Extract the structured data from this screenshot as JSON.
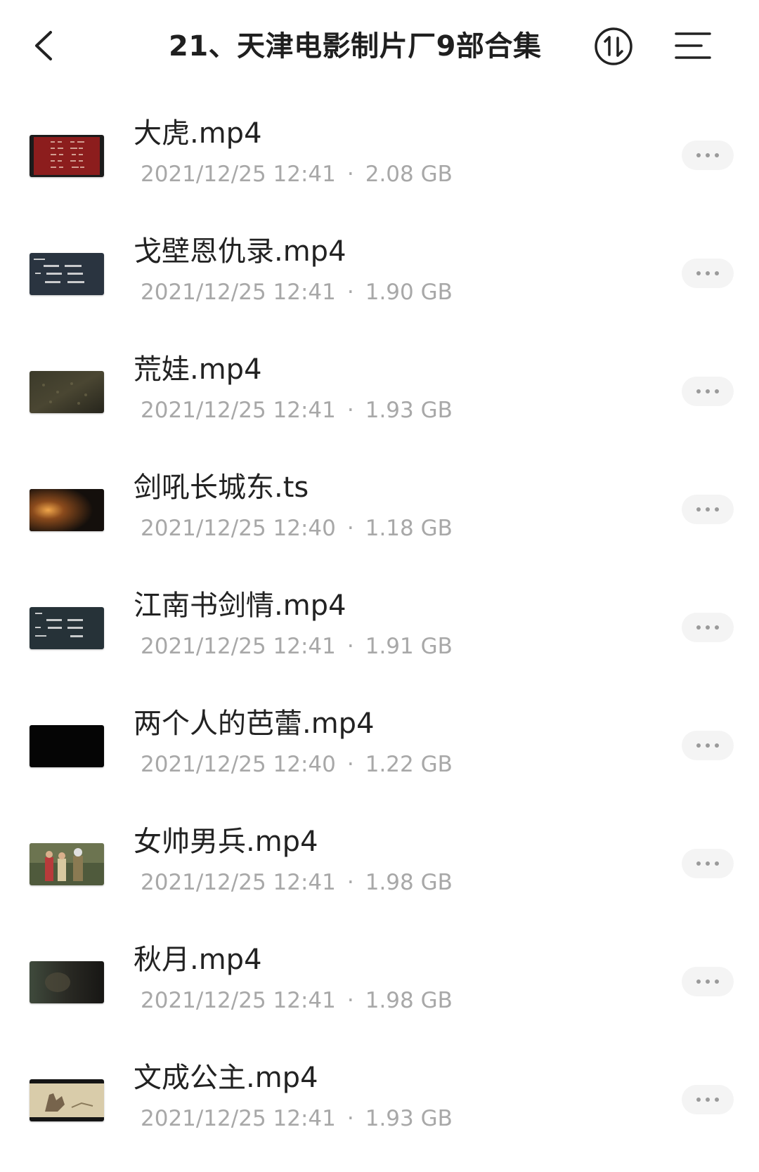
{
  "header": {
    "title": "21、天津电影制片厂9部合集",
    "back_icon": "chevron-left-icon",
    "sort_icon": "sort-arrows-icon",
    "menu_icon": "menu-lines-icon"
  },
  "files": [
    {
      "name": "大虎.mp4",
      "date": "2021/12/25 12:41",
      "size": "2.08 GB",
      "thumb": "red-credits"
    },
    {
      "name": "戈壁恩仇录.mp4",
      "date": "2021/12/25 12:41",
      "size": "1.90 GB",
      "thumb": "dark-credits"
    },
    {
      "name": "荒娃.mp4",
      "date": "2021/12/25 12:41",
      "size": "1.93 GB",
      "thumb": "dark-field"
    },
    {
      "name": "剑吼长城东.ts",
      "date": "2021/12/25 12:40",
      "size": "1.18 GB",
      "thumb": "fire-night"
    },
    {
      "name": "江南书剑情.mp4",
      "date": "2021/12/25 12:41",
      "size": "1.91 GB",
      "thumb": "dark-credits"
    },
    {
      "name": "两个人的芭蕾.mp4",
      "date": "2021/12/25 12:40",
      "size": "1.22 GB",
      "thumb": "black"
    },
    {
      "name": "女帅男兵.mp4",
      "date": "2021/12/25 12:41",
      "size": "1.98 GB",
      "thumb": "outdoor-people"
    },
    {
      "name": "秋月.mp4",
      "date": "2021/12/25 12:41",
      "size": "1.98 GB",
      "thumb": "dark-scene"
    },
    {
      "name": "文成公主.mp4",
      "date": "2021/12/25 12:41",
      "size": "1.93 GB",
      "thumb": "sepia-painting"
    }
  ],
  "colors": {
    "title_text": "#1f1f1f",
    "name_text": "#222222",
    "meta_text": "#a8a8a8",
    "more_bg": "#f4f4f4"
  }
}
